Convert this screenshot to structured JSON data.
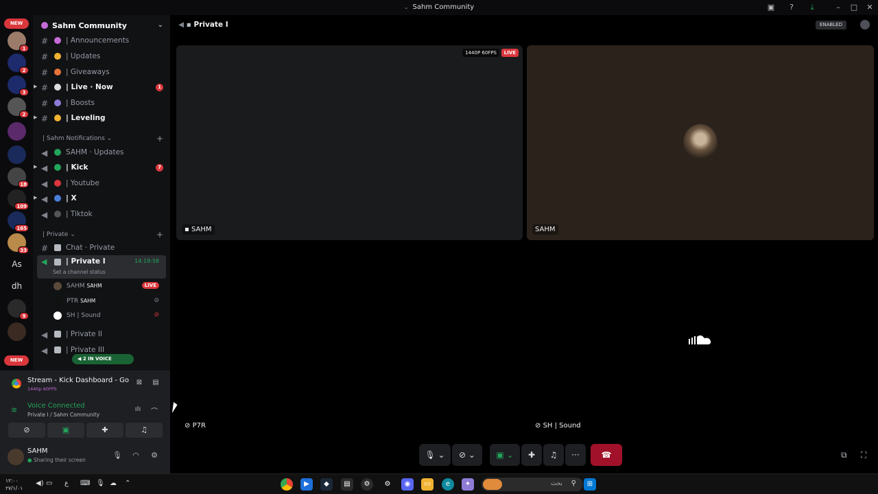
{
  "window": {
    "title": "Sahm Community"
  },
  "rail": {
    "new_top": "NEW",
    "new_bottom": "NEW",
    "servers": [
      {
        "badge": "1",
        "text": ""
      },
      {
        "badge": "2",
        "text": ""
      },
      {
        "badge": "3",
        "text": ""
      },
      {
        "badge": "2",
        "text": ""
      },
      {
        "badge": "",
        "text": ""
      },
      {
        "badge": "",
        "text": ""
      },
      {
        "badge": "18",
        "text": ""
      },
      {
        "badge": "109",
        "text": ""
      },
      {
        "badge": "165",
        "text": ""
      },
      {
        "badge": "33",
        "text": ""
      },
      {
        "badge": "",
        "text": "As"
      },
      {
        "badge": "",
        "text": "dh"
      },
      {
        "badge": "9",
        "text": ""
      },
      {
        "badge": "",
        "text": ""
      }
    ]
  },
  "sidebar": {
    "server_name": "Sahm Community",
    "channels_top": [
      {
        "name": "| Announcements",
        "bold": false,
        "count": "",
        "color": "#c56bd8"
      },
      {
        "name": "| Updates",
        "bold": false,
        "count": "",
        "color": "#f0b232"
      },
      {
        "name": "| Giveaways",
        "bold": false,
        "count": "",
        "color": "#e8743b"
      },
      {
        "name": "| Live · Now",
        "bold": true,
        "count": "1",
        "color": "#dbdee1"
      },
      {
        "name": "| Boosts",
        "bold": false,
        "count": "",
        "color": "#8d7bd6"
      },
      {
        "name": "| Leveling",
        "bold": true,
        "count": "",
        "color": "#f0b232"
      }
    ],
    "category_notifications": "| Sahm Notifications",
    "channels_notif": [
      {
        "name": "SAHM · Updates",
        "bold": false,
        "count": "",
        "color": "#23a55a"
      },
      {
        "name": "| Kick",
        "bold": true,
        "count": "7",
        "color": "#23a55a"
      },
      {
        "name": "| Youtube",
        "bold": false,
        "count": "",
        "color": "#da373c"
      },
      {
        "name": "| X",
        "bold": true,
        "count": "",
        "color": "#4a7fd8"
      },
      {
        "name": "| Tiktok",
        "bold": false,
        "count": "",
        "color": "#555"
      }
    ],
    "category_private": "| Private",
    "chat_private": "Chat · Private",
    "selected_channel": "| Private I",
    "selected_time": "14:19:58",
    "selected_status": "Set a channel status",
    "voice_users": [
      {
        "name": "SAHM",
        "tag": "SAHM",
        "live": "LIVE"
      },
      {
        "name": "PTR",
        "tag": "SAHM",
        "live": ""
      },
      {
        "name": "SH | Sound",
        "tag": "",
        "live": ""
      }
    ],
    "private_ii": "| Private II",
    "private_iii": "| Private III",
    "in_voice": "2 IN VOICE"
  },
  "panel": {
    "stream_title": "Stream - Kick Dashboard - Go...",
    "stream_quality": "1440p 60FPS",
    "voice_connected": "Voice Connected",
    "voice_channel": "Private I / Sahm Community",
    "username": "SAHM",
    "user_status": "Sharing their screen"
  },
  "main": {
    "channel_title": "Private I",
    "enabled": "ENABLED",
    "tiles": [
      {
        "label": "SAHM",
        "quality": "1440P 60FPS",
        "live": "LIVE"
      },
      {
        "label": "SAHM"
      },
      {
        "label": "P7R"
      },
      {
        "label": "SH | Sound"
      }
    ]
  },
  "taskbar": {
    "time": "١٢:٠٠",
    "date": "٢٧/١/٠١",
    "lang": "ع",
    "search_placeholder": "بحث"
  }
}
